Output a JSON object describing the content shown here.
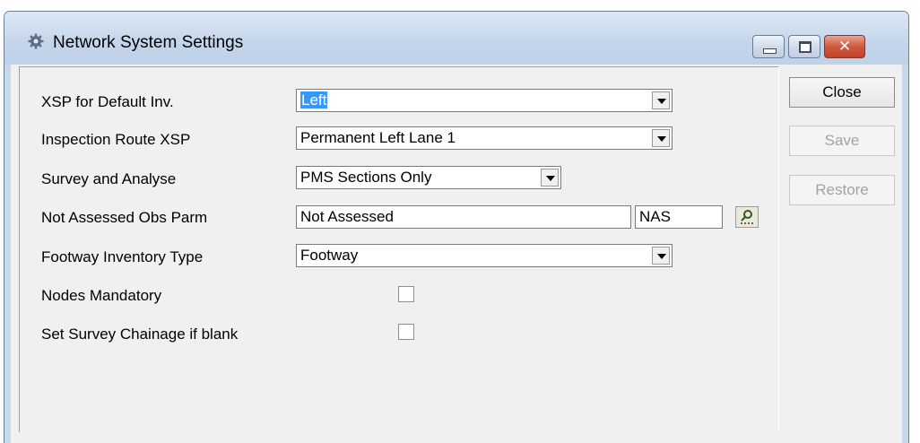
{
  "window": {
    "title": "Network System Settings",
    "icon": "gear-icon",
    "controls": [
      "minimize-icon",
      "maximize-icon",
      "close-icon"
    ],
    "close_glyph": "✕"
  },
  "form": {
    "xsp_default_inv": {
      "label": "XSP for Default Inv.",
      "value": "Left"
    },
    "inspection_route_xsp": {
      "label": "Inspection Route XSP",
      "value": "Permanent Left Lane 1"
    },
    "survey_and_analyse": {
      "label": "Survey and Analyse",
      "value": "PMS Sections Only"
    },
    "not_assessed_obs_parm": {
      "label": "Not Assessed Obs Parm",
      "value": "Not Assessed",
      "code": "NAS"
    },
    "footway_inventory_type": {
      "label": "Footway Inventory Type",
      "value": "Footway"
    },
    "nodes_mandatory": {
      "label": "Nodes Mandatory",
      "checked": false
    },
    "set_survey_chainage": {
      "label": "Set Survey Chainage if blank",
      "checked": false
    }
  },
  "buttons": {
    "close": "Close",
    "save": "Save",
    "restore": "Restore"
  },
  "colors": {
    "selection": "#3399ff",
    "close_button": "#c7472c",
    "disabled_text": "#a3a3a3"
  }
}
